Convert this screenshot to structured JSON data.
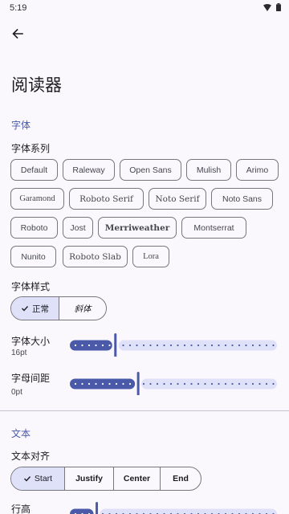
{
  "status": {
    "time": "5:19",
    "icons": [
      "wifi-icon",
      "battery-icon"
    ]
  },
  "header": {
    "back_icon": "arrow-left-icon"
  },
  "page": {
    "title": "阅读器"
  },
  "font_section": {
    "header": "字体",
    "family_label": "字体系列",
    "chips": [
      {
        "label": "Default",
        "selected": true
      },
      {
        "label": "Raleway",
        "selected": false
      },
      {
        "label": "Open Sans",
        "selected": false
      },
      {
        "label": "Mulish",
        "selected": false
      },
      {
        "label": "Arimo",
        "selected": false
      },
      {
        "label": "Garamond",
        "selected": false
      },
      {
        "label": "Roboto Serif",
        "selected": false
      },
      {
        "label": "Noto Serif",
        "selected": false
      },
      {
        "label": "Noto Sans",
        "selected": false
      },
      {
        "label": "Roboto",
        "selected": false
      },
      {
        "label": "Jost",
        "selected": false
      },
      {
        "label": "Merriweather",
        "selected": false
      },
      {
        "label": "Montserrat",
        "selected": false
      },
      {
        "label": "Nunito",
        "selected": false
      },
      {
        "label": "Roboto Slab",
        "selected": false
      },
      {
        "label": "Lora",
        "selected": false
      }
    ],
    "style_label": "字体样式",
    "style_options": [
      {
        "label": "正常",
        "selected": true
      },
      {
        "label": "斜体",
        "selected": false
      }
    ],
    "size_label": "字体大小",
    "size_value": "16pt",
    "size_fraction": 0.22,
    "spacing_label": "字母间距",
    "spacing_value": "0pt",
    "spacing_fraction": 0.33
  },
  "text_section": {
    "header": "文本",
    "align_label": "文本对齐",
    "align_options": [
      {
        "label": "Start",
        "selected": true
      },
      {
        "label": "Justify",
        "selected": false
      },
      {
        "label": "Center",
        "selected": false
      },
      {
        "label": "End",
        "selected": false
      }
    ],
    "line_height_label": "行高",
    "line_height_fraction": 0.13
  },
  "colors": {
    "accent": "#4a5aa8",
    "active_track": "#4a5aa8",
    "inactive_track": "#dfe1f9",
    "selected_bg": "#dfe1f9"
  }
}
